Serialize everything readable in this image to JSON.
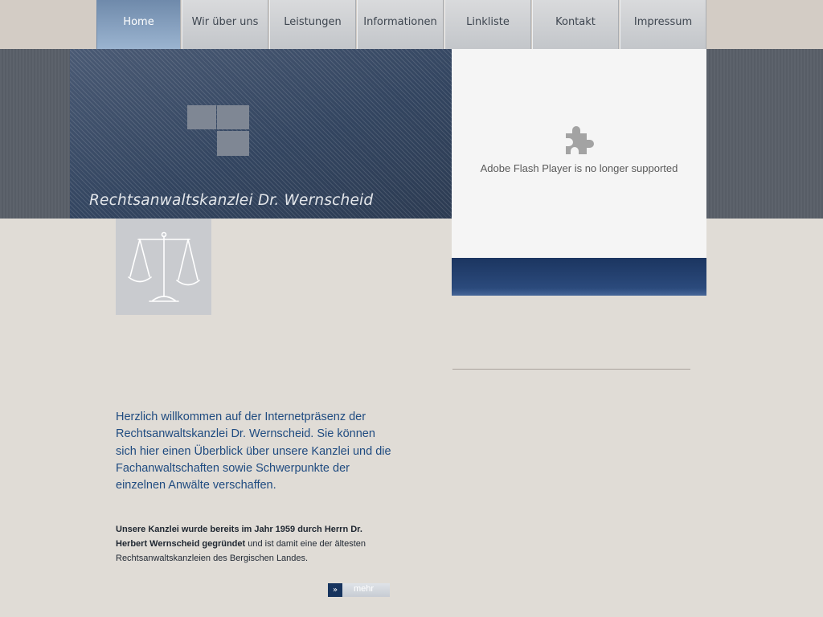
{
  "nav": {
    "items": [
      {
        "label": "Home",
        "active": true
      },
      {
        "label": "Wir über uns"
      },
      {
        "label": "Leistungen"
      },
      {
        "label": "Informationen"
      },
      {
        "label": "Linkliste"
      },
      {
        "label": "Kontakt"
      },
      {
        "label": "Impressum"
      }
    ]
  },
  "hero": {
    "title": "Rechtsanwaltskanzlei Dr. Wernscheid"
  },
  "flash": {
    "message": "Adobe Flash Player is no longer supported",
    "icon": "puzzle-piece-icon"
  },
  "scales": {
    "icon": "scales-of-justice-icon"
  },
  "content": {
    "intro": "Herzlich willkommen auf der Internetpräsenz der Rechtsanwaltskanzlei Dr. Wernscheid. Sie können sich hier einen Überblick über unsere Kanzlei und die Fachanwaltschaften sowie Schwerpunkte der einzelnen Anwälte verschaffen.",
    "history_bold": "Unsere Kanzlei wurde bereits im Jahr 1959 durch Herrn Dr. Herbert Wernscheid gegründet",
    "history_rest": " und ist damit eine der ältesten Rechtsanwaltskanzleien des Bergischen Landes.",
    "more_arrow": "»",
    "more_label": "mehr"
  },
  "colors": {
    "background": "#e0dcd6",
    "nav_active": "#7f9bbd",
    "intro_text": "#1f4b80",
    "accent_blue": "#17345e"
  }
}
